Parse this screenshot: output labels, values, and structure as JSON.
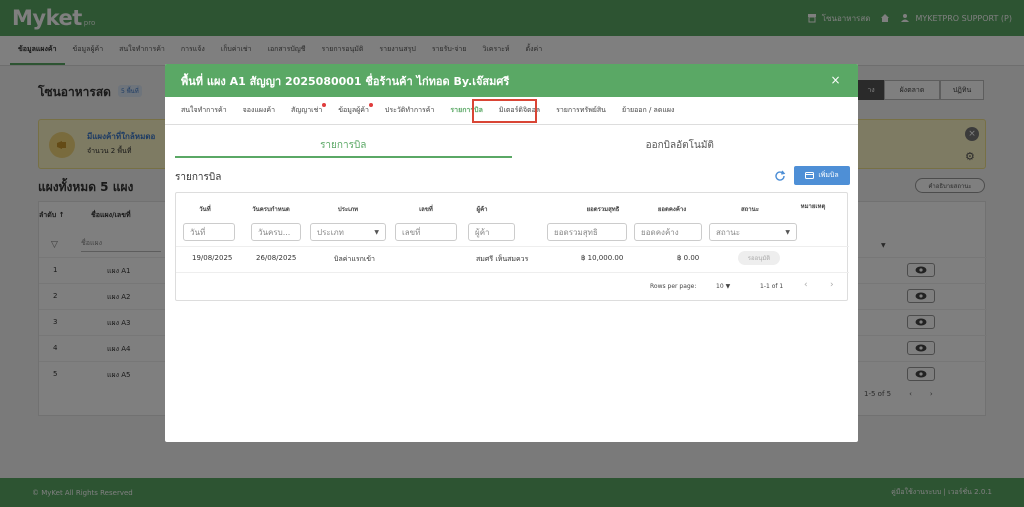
{
  "app": {
    "logo_main": "Myket",
    "logo_sub": "pro",
    "market_name": "โซนอาหารสด",
    "user_name": "MYKETPRO SUPPORT (P)"
  },
  "nav": [
    "ข้อมูลแผงค้า",
    "ข้อมูลผู้ค้า",
    "สนใจทำการค้า",
    "การแจ้ง",
    "เก็บค่าเช่า",
    "เอกสารบัญชี",
    "รายการอนุมัติ",
    "รายงานสรุป",
    "รายรับ-จ่าย",
    "วิเคราะห์",
    "ตั้งค่า"
  ],
  "page": {
    "title": "โซนอาหารสด",
    "badge": "5 พื้นที่",
    "right_tabs": [
      "าง",
      "ผังตลาด",
      "ปฏิทิน"
    ],
    "notice_title": "มีแผงค้าที่ใกล้หมดอ",
    "notice_sub": "จำนวน 2 พื้นที่",
    "total_title": "แผงทั้งหมด 5 แผง",
    "status_button": "คำอธิบายสถานะ",
    "col_order": "ลำดับ ↑",
    "col_name": "ชื่อแผง/เลขที่",
    "filter_name": "ชื่อแผง",
    "rows": [
      {
        "num": "1",
        "name": "แผง A1"
      },
      {
        "num": "2",
        "name": "แผง A2"
      },
      {
        "num": "3",
        "name": "แผง A3"
      },
      {
        "num": "4",
        "name": "แผง A4"
      },
      {
        "num": "5",
        "name": "แผง A5"
      }
    ],
    "pager": "1-5 of 5"
  },
  "footer": {
    "left": "© MyKet All Rights Reserved",
    "right": "คู่มือใช้งานระบบ | เวอร์ชั่น 2.0.1"
  },
  "modal": {
    "title": "พื้นที่ แผง A1 สัญญา 2025080001 ชื่อร้านค้า ไก่ทอด By.เจ๊สมศรี",
    "close": "×",
    "tabs": [
      {
        "label": "สนใจทำการค้า",
        "dot": false
      },
      {
        "label": "จองแผงค้า",
        "dot": false
      },
      {
        "label": "สัญญาเช่า",
        "dot": true
      },
      {
        "label": "ข้อมูลผู้ค้า",
        "dot": true
      },
      {
        "label": "ประวัติทำการค้า",
        "dot": false
      },
      {
        "label": "รายการบิล",
        "dot": false
      },
      {
        "label": "มิเตอร์ดิจิตอล",
        "dot": false
      },
      {
        "label": "รายการทรัพย์สิน",
        "dot": false
      },
      {
        "label": "ย้ายออก / ลดแผง",
        "dot": false
      }
    ],
    "active_tab": 5,
    "subtabs": [
      "รายการบิล",
      "ออกบิลอัตโนมัติ"
    ],
    "section_title": "รายการบิล",
    "add_label": "เพิ่มบิล",
    "table": {
      "headers": [
        "วันที่",
        "วันครบกำหนด",
        "ประเภท",
        "เลขที่",
        "ผู้ค้า",
        "ยอดรวมสุทธิ",
        "ยอดคงค้าง",
        "สถานะ",
        "หมายเหตุ"
      ],
      "filters": [
        "วันที่",
        "วันครบ...",
        "ประเภท",
        "เลขที่",
        "ผู้ค้า",
        "ยอดรวมสุทธิ",
        "ยอดคงค้าง",
        "สถานะ"
      ],
      "row": {
        "date": "19/08/2025",
        "due": "26/08/2025",
        "type": "บิลค่าแรกเข้า",
        "number": "",
        "merchant": "สมศรี เห็นสมควร",
        "total": "฿ 10,000.00",
        "balance": "฿ 0.00",
        "status": "รออนุมัติ",
        "note": ""
      },
      "rows_per_page_label": "Rows per page:",
      "rows_per_page": "10",
      "range": "1-1 of 1"
    }
  },
  "colors": {
    "brand_green": "#5aa865",
    "add_blue": "#4e8fd6",
    "highlight_red": "#d94535"
  }
}
